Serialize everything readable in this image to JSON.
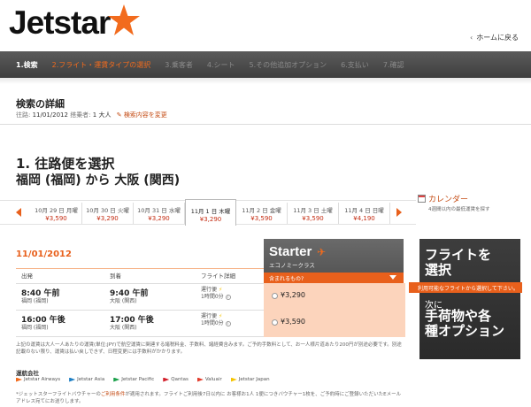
{
  "brand": {
    "name": "Jetstar",
    "accent": "#f26b1d"
  },
  "header": {
    "home_link": "ホームに戻る"
  },
  "steps": [
    {
      "label": "1.検索",
      "state": "current"
    },
    {
      "label": "2.フライト・運賃タイプの選択",
      "state": "active"
    },
    {
      "label": "3.乗客者",
      "state": "upcoming"
    },
    {
      "label": "4.シート",
      "state": "upcoming"
    },
    {
      "label": "5.その他追加オプション",
      "state": "upcoming"
    },
    {
      "label": "6.支払い",
      "state": "upcoming"
    },
    {
      "label": "7.確認",
      "state": "upcoming"
    }
  ],
  "search_details": {
    "title": "検索の詳細",
    "date_label": "往路:",
    "date_value": "11/01/2012",
    "pax_label": "搭乗者:",
    "pax_value": "1 大人",
    "edit_link": "検索内容を変更"
  },
  "leg": {
    "title": "1. 往路便を選択",
    "route": "福岡 (福岡) から 大阪 (関西)"
  },
  "calendar": {
    "label": "カレンダー",
    "note": "4週間以内の最低運賃を探す"
  },
  "dates": [
    {
      "date": "10月 29 日 月曜",
      "price": "¥3,590",
      "selected": false
    },
    {
      "date": "10月 30 日 火曜",
      "price": "¥3,290",
      "selected": false
    },
    {
      "date": "10月 31 日 水曜",
      "price": "¥3,290",
      "selected": false
    },
    {
      "date": "11月 1 日 木曜",
      "price": "¥3,290",
      "selected": true
    },
    {
      "date": "11月 2 日 金曜",
      "price": "¥3,590",
      "selected": false
    },
    {
      "date": "11月 3 日 土曜",
      "price": "¥3,590",
      "selected": false
    },
    {
      "date": "11月 4 日 日曜",
      "price": "¥4,190",
      "selected": false
    }
  ],
  "flights_panel": {
    "date": "11/01/2012",
    "col_depart": "出発",
    "col_arrive": "到着",
    "col_detail": "フライト詳細",
    "fare": {
      "name": "Starter",
      "class": "エコノミークラス",
      "bar_text": "含まれるもの?"
    },
    "rows": [
      {
        "dep_time": "8:40 午前",
        "dep_place": "福岡 (福岡)",
        "arr_time": "9:40 午前",
        "arr_place": "大阪 (関西)",
        "detail1": "運行便",
        "detail2": "1時間0分",
        "price": "¥3,290"
      },
      {
        "dep_time": "16:00 午後",
        "dep_place": "福岡 (福岡)",
        "arr_time": "17:00 午後",
        "arr_place": "大阪 (関西)",
        "detail1": "運行便",
        "detail2": "1時間0分",
        "price": "¥3,590"
      }
    ]
  },
  "promo": {
    "line1": "フライトを",
    "line2": "選択",
    "band": "利用可能なフライトから選択して下さい。",
    "next": "次に",
    "line3": "手荷物や各",
    "line4": "種オプション"
  },
  "fine_print_1": "上記の運賃は大人一人あたりの運賃(単位:JPY)で航空運賃に関連する諸税料金、手数料、諸経費含みます。ご予約手数料として、お一人様片道あたり200円が別途必要です。別途記載のない限り、運賃は払い戻しできず、日程変更には手数料がかかります。",
  "carriers": {
    "title": "運航会社",
    "items": [
      {
        "name": "Jetstar Airways",
        "color": "#f26b1d"
      },
      {
        "name": "Jetstar Asia",
        "color": "#1f7fc4"
      },
      {
        "name": "Jetstar Pacific",
        "color": "#1aa04a"
      },
      {
        "name": "Qantas",
        "color": "#d21f2b"
      },
      {
        "name": "Valuair",
        "color": "#e23b2b"
      },
      {
        "name": "Jetstar Japan",
        "color": "#f5c400"
      }
    ]
  },
  "fine_print_2": {
    "prefix": "*ジェットスターフライトバウチャーの",
    "link": "ご利用条件",
    "suffix": "が適用されます。フライトご利用後7日以内に お客様お1人 1便につきバウチャー1枚を、ご予約時にご登録いただいたEメールアドレス宛てにお送りします。"
  }
}
